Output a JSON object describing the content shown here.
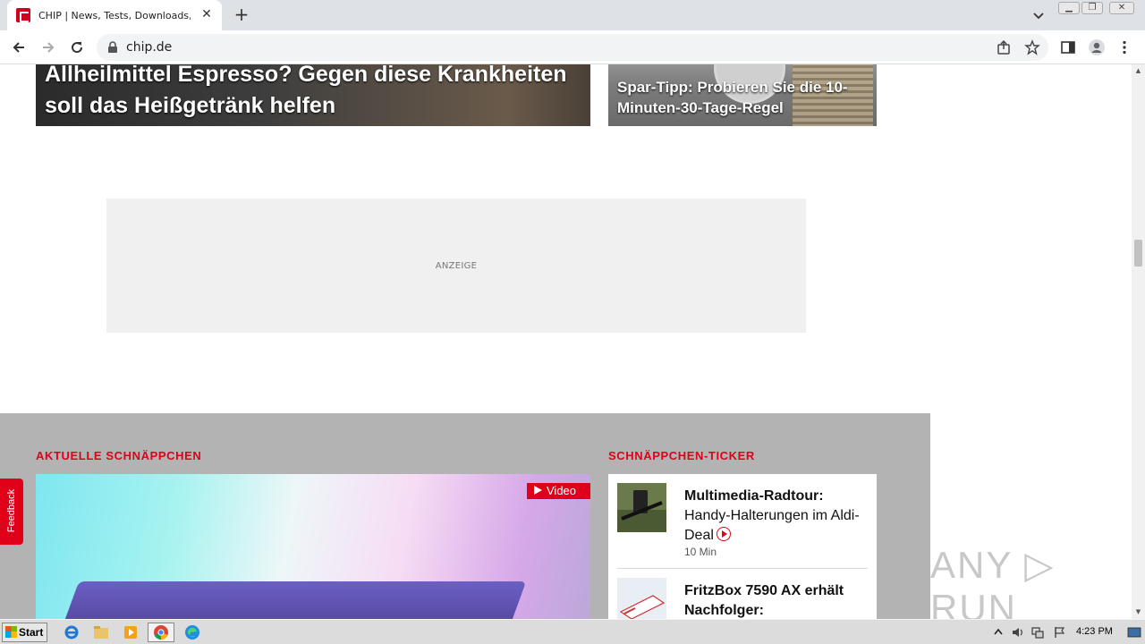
{
  "browser": {
    "tab_title": "CHIP | News, Tests, Downloads, Tech",
    "url": "chip.de",
    "window_controls": [
      "minimize",
      "restore",
      "close"
    ]
  },
  "page": {
    "top_cards": [
      {
        "title": "Allheilmittel Espresso? Gegen diese Krankheiten soll das Heißgetränk helfen"
      },
      {
        "title": "Spar-Tipp: Probieren Sie die 10-Minuten-30-Tage-Regel"
      }
    ],
    "ad_label": "ANZEIGE",
    "deals": {
      "title": "AKTUELLE SCHNÄPPCHEN",
      "video_badge": "Video"
    },
    "ticker": {
      "title": "SCHNÄPPCHEN-TICKER",
      "items": [
        {
          "headline_bold": "Multimedia-Radtour:",
          "headline_rest": "Handy-Halterungen im Aldi-Deal",
          "time": "10 Min"
        },
        {
          "headline_bold": "FritzBox 7590 AX erhält Nachfolger:",
          "headline_rest": "",
          "time": ""
        }
      ]
    },
    "feedback_label": "Feedback",
    "watermark": "ANY ▷ RUN"
  },
  "taskbar": {
    "start_label": "Start",
    "clock": "4:23 PM"
  },
  "colors": {
    "accent_red": "#e1001a",
    "deals_bg": "#b3b3b3",
    "ad_bg": "#f0f0f0"
  }
}
